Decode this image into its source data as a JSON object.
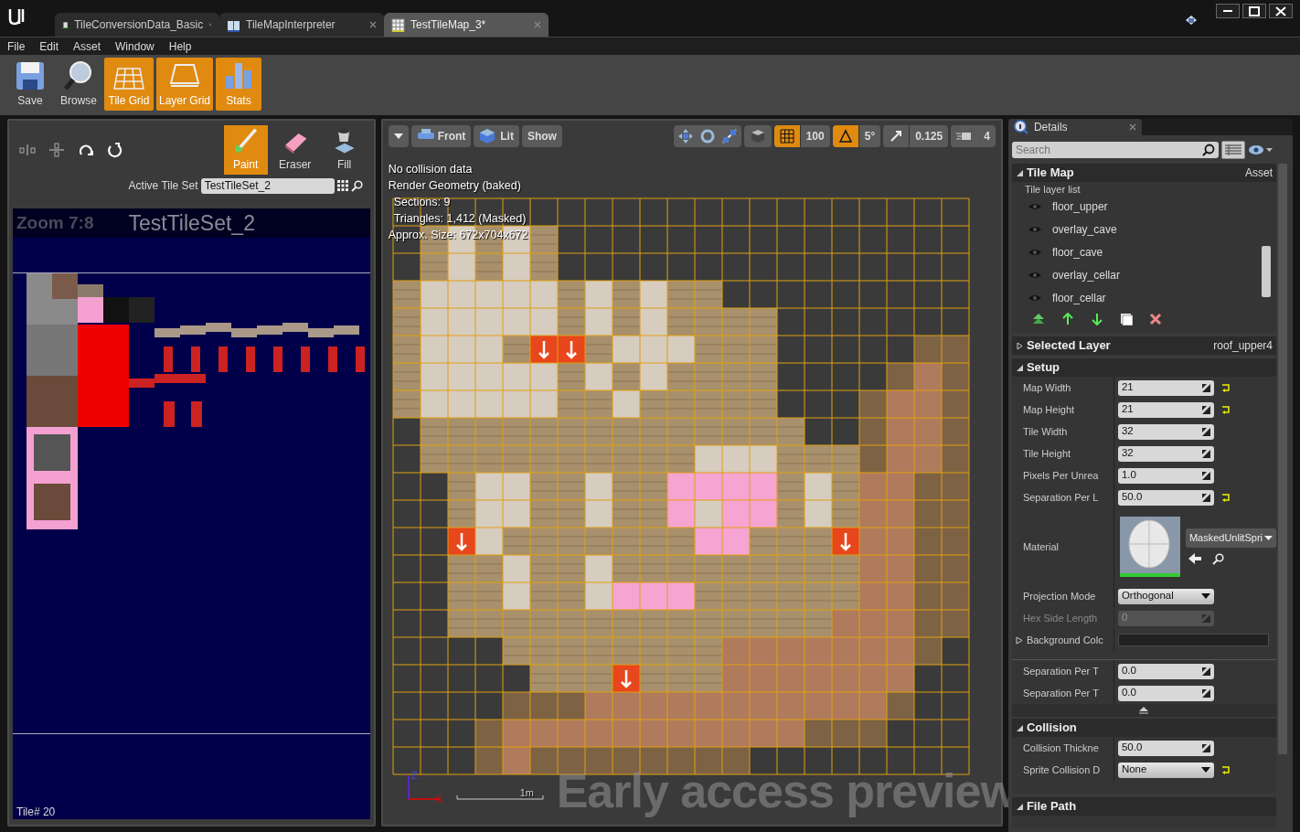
{
  "window": {
    "tabs": [
      {
        "label": "TileConversionData_Basic",
        "selected": false,
        "kind": "data"
      },
      {
        "label": "TileMapInterpreter",
        "selected": false,
        "kind": "book"
      },
      {
        "label": "TestTileMap_3*",
        "selected": true,
        "kind": "map"
      }
    ],
    "menu": [
      "File",
      "Edit",
      "Asset",
      "Window",
      "Help"
    ]
  },
  "toolbar": [
    {
      "label": "Save",
      "kind": "save",
      "on": false
    },
    {
      "label": "Browse",
      "kind": "browse",
      "on": false
    },
    {
      "label": "Tile Grid",
      "kind": "tilegrid",
      "on": true
    },
    {
      "label": "Layer Grid",
      "kind": "layergrid",
      "on": true
    },
    {
      "label": "Stats",
      "kind": "stats",
      "on": true
    }
  ],
  "tile_palette": {
    "tools": [
      {
        "label": "Paint",
        "kind": "paint",
        "selected": true
      },
      {
        "label": "Eraser",
        "kind": "eraser",
        "selected": false
      },
      {
        "label": "Fill",
        "kind": "fill",
        "selected": false
      }
    ],
    "active_tile_set_label": "Active Tile Set",
    "active_tile_set": "TestTileSet_2",
    "zoom": "Zoom 7:8",
    "title": "TestTileSet_2",
    "tile_number": "Tile# 20"
  },
  "viewport": {
    "view_buttons": [
      {
        "label": "Front",
        "kind": "front"
      },
      {
        "label": "Lit",
        "kind": "lit"
      },
      {
        "label": "Show",
        "kind": "plain"
      }
    ],
    "grid_snap": {
      "value": "100",
      "on": true
    },
    "rotation_snap": {
      "value": "5°",
      "on": true
    },
    "scale_snap": {
      "value": "0.125",
      "on": false
    },
    "camera_speed": "4",
    "info": [
      "No collision data",
      "Render Geometry (baked)",
      "Sections: 9",
      "Triangles: 1,412 (Masked)",
      "Approx. Size: 672x704x672"
    ],
    "axis_labels": [
      "Z",
      "X"
    ],
    "scale_label": "1m",
    "watermark": "Early access preview"
  },
  "details": {
    "title": "Details",
    "search": {
      "placeholder": "Search"
    },
    "tile_map": {
      "title": "Tile Map",
      "category": "Asset",
      "expanded": true,
      "layer_list_label": "Tile layer list",
      "layers": [
        "floor_upper",
        "overlay_cave",
        "floor_cave",
        "overlay_cellar",
        "floor_cellar"
      ]
    },
    "selected_layer": {
      "title": "Selected Layer",
      "value": "roof_upper4",
      "expanded": false
    },
    "setup": {
      "title": "Setup",
      "expanded": true,
      "properties": [
        {
          "label": "Map Width",
          "value": "21",
          "kind": "number",
          "reset": true,
          "disabled": false
        },
        {
          "label": "Map Height",
          "value": "21",
          "kind": "number",
          "reset": true,
          "disabled": false
        },
        {
          "label": "Tile Width",
          "value": "32",
          "kind": "number",
          "reset": false,
          "disabled": false
        },
        {
          "label": "Tile Height",
          "value": "32",
          "kind": "number",
          "reset": false,
          "disabled": false
        },
        {
          "label": "Pixels Per Unrea",
          "value": "1.0",
          "kind": "number",
          "reset": false,
          "disabled": false
        },
        {
          "label": "Separation Per L",
          "value": "50.0",
          "kind": "number",
          "reset": true,
          "disabled": false
        },
        {
          "label": "Material",
          "value": "MaskedUnlitSpri",
          "kind": "material",
          "reset": false,
          "disabled": false
        },
        {
          "label": "Projection Mode",
          "value": "Orthogonal",
          "kind": "dropdown",
          "reset": false,
          "disabled": false
        },
        {
          "label": "Hex Side Length",
          "value": "0",
          "kind": "number",
          "reset": false,
          "disabled": true
        },
        {
          "label": "Background Colc",
          "kind": "color",
          "reset": false,
          "disabled": false
        }
      ],
      "advanced": [
        {
          "label": "Separation Per T",
          "value": "0.0",
          "kind": "number",
          "reset": false,
          "disabled": false
        },
        {
          "label": "Separation Per T",
          "value": "0.0",
          "kind": "number",
          "reset": false,
          "disabled": false
        }
      ]
    },
    "collision": {
      "title": "Collision",
      "expanded": true,
      "properties": [
        {
          "label": "Collision Thickne",
          "value": "50.0",
          "kind": "number",
          "reset": false,
          "disabled": false
        },
        {
          "label": "Sprite Collision D",
          "value": "None",
          "kind": "dropdown",
          "reset": true,
          "disabled": false
        }
      ]
    },
    "file_path": {
      "title": "File Path",
      "expanded": true
    }
  }
}
